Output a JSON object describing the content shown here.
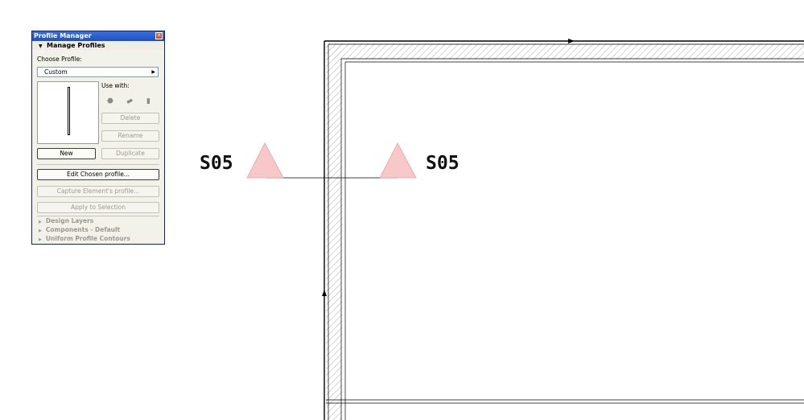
{
  "palette": {
    "title": "Profile Manager",
    "close_glyph": "✕",
    "section_title": "Manage Profiles",
    "choose_label": "Choose Profile:",
    "chosen_profile": "Custom",
    "use_with_label": "Use with:",
    "use_with_icons": [
      "wall-icon",
      "beam-icon",
      "column-icon"
    ],
    "buttons": {
      "delete": "Delete",
      "rename": "Rename",
      "new": "New",
      "duplicate": "Duplicate",
      "edit": "Edit Chosen profile...",
      "capture": "Capture Element's profile...",
      "apply": "Apply to Selection"
    },
    "collapsed_sections": [
      "Design Layers",
      "Components - Default",
      "Uniform Profile Contours"
    ]
  },
  "section_markers": {
    "left_label": "S05",
    "right_label": "S05",
    "marker_color": "#f8c7c7"
  }
}
